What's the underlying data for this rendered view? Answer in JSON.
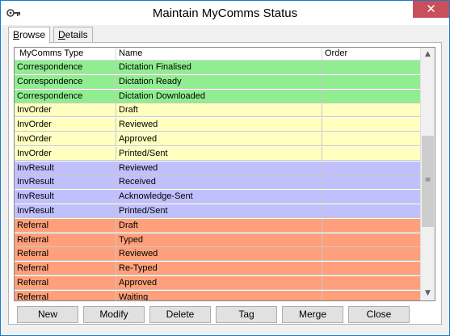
{
  "window": {
    "title": "Maintain MyComms Status",
    "close_glyph": "✕",
    "icon": "key-icon"
  },
  "tabs": [
    {
      "label": "Browse",
      "accel": "B",
      "rest": "rowse",
      "active": true
    },
    {
      "label": "Details",
      "accel": "D",
      "rest": "etails",
      "active": false
    }
  ],
  "grid": {
    "columns": [
      "MyComms Type",
      "Name",
      "Order"
    ],
    "rows": [
      {
        "type": "Correspondence",
        "name": "Dictation Finalised",
        "order": "",
        "color": "#90ee90"
      },
      {
        "type": "Correspondence",
        "name": "Dictation Ready",
        "order": "",
        "color": "#90ee90"
      },
      {
        "type": "Correspondence",
        "name": "Dictation Downloaded",
        "order": "",
        "color": "#90ee90"
      },
      {
        "type": "InvOrder",
        "name": "Draft",
        "order": "",
        "color": "#ffffc0"
      },
      {
        "type": "InvOrder",
        "name": "Reviewed",
        "order": "",
        "color": "#ffffc0"
      },
      {
        "type": "InvOrder",
        "name": "Approved",
        "order": "",
        "color": "#ffffc0"
      },
      {
        "type": "InvOrder",
        "name": "Printed/Sent",
        "order": "",
        "color": "#ffffc0"
      },
      {
        "type": "InvResult",
        "name": "Reviewed",
        "order": "",
        "color": "#c0c0ff"
      },
      {
        "type": "InvResult",
        "name": "Received",
        "order": "",
        "color": "#c0c0ff"
      },
      {
        "type": "InvResult",
        "name": "Acknowledge-Sent",
        "order": "",
        "color": "#c0c0ff"
      },
      {
        "type": "InvResult",
        "name": "Printed/Sent",
        "order": "",
        "color": "#c0c0ff"
      },
      {
        "type": "Referral",
        "name": "Draft",
        "order": "",
        "color": "#ffa07a"
      },
      {
        "type": "Referral",
        "name": "Typed",
        "order": "",
        "color": "#ffa07a"
      },
      {
        "type": "Referral",
        "name": "Reviewed",
        "order": "",
        "color": "#ffa07a"
      },
      {
        "type": "Referral",
        "name": "Re-Typed",
        "order": "",
        "color": "#ffa07a"
      },
      {
        "type": "Referral",
        "name": "Approved",
        "order": "",
        "color": "#ffa07a"
      },
      {
        "type": "Referral",
        "name": "Waiting",
        "order": "",
        "color": "#ffa07a"
      }
    ],
    "scrollbar": {
      "up_glyph": "▲",
      "down_glyph": "▼",
      "grip_glyph": "≡"
    }
  },
  "buttons": [
    "New",
    "Modify",
    "Delete",
    "Tag",
    "Merge",
    "Close"
  ]
}
